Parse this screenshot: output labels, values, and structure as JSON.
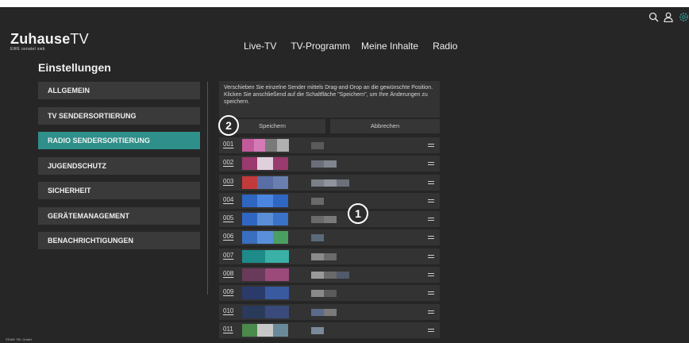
{
  "brand": {
    "name": "Zuhause",
    "name_suffix": "TV",
    "sub": "EWE osnatel swb"
  },
  "nav": {
    "items": [
      "Live-TV",
      "TV-Programm",
      "Meine Inhalte",
      "Radio"
    ]
  },
  "header_icons": [
    "search-icon",
    "user-icon",
    "settings-icon"
  ],
  "colors": {
    "background": "#262626",
    "panel": "#333333",
    "accent": "#2f8f8a",
    "settings_icon": "#2f8f8a"
  },
  "page": {
    "title": "Einstellungen"
  },
  "sidebar": {
    "items": [
      {
        "label": "ALLGEMEIN",
        "active": false
      },
      {
        "label": "TV SENDERSORTIERUNG",
        "active": false
      },
      {
        "label": "RADIO SENDERSORTIERUNG",
        "active": true
      },
      {
        "label": "JUGENDSCHUTZ",
        "active": false
      },
      {
        "label": "SICHERHEIT",
        "active": false
      },
      {
        "label": "GERÄTEMANAGEMENT",
        "active": false
      },
      {
        "label": "BENACHRICHTIGUNGEN",
        "active": false
      }
    ]
  },
  "main": {
    "info_text": "Verschieben Sie einzelne Sender mittels Drag-and-Drop an die gewünschte Position. Klicken Sie anschließend auf die Schaltfläche \"Speichern\", um Ihre Änderungen zu speichern.",
    "save_label": "Speichern",
    "cancel_label": "Abbrechen",
    "marker_1": "1",
    "marker_2": "2",
    "stations": [
      {
        "number": "001",
        "logo_colors": [
          "#c25a9a",
          "#d47ab6",
          "#7a7a7a",
          "#b0b0b0"
        ],
        "name_colors": [
          "#5a5a5a"
        ]
      },
      {
        "number": "002",
        "logo_colors": [
          "#9b3a6e",
          "#e0d0dc",
          "#9b3a6e"
        ],
        "name_colors": [
          "#6a6f7a",
          "#7f858f"
        ]
      },
      {
        "number": "003",
        "logo_colors": [
          "#c33a3a",
          "#5a6ea6",
          "#6a7fae"
        ],
        "name_colors": [
          "#7a7f88",
          "#8f939b",
          "#6c7079"
        ]
      },
      {
        "number": "004",
        "logo_colors": [
          "#2f66c2",
          "#4a86e0",
          "#2f66c2"
        ],
        "name_colors": [
          "#6a6a6a"
        ]
      },
      {
        "number": "005",
        "logo_colors": [
          "#2f66c2",
          "#5a8ed6",
          "#3a72c8"
        ],
        "name_colors": [
          "#6a6a6a",
          "#7a7a7a"
        ]
      },
      {
        "number": "006",
        "logo_colors": [
          "#3a6ec0",
          "#5a90da",
          "#4aa060"
        ],
        "name_colors": [
          "#5a6a7a"
        ]
      },
      {
        "number": "007",
        "logo_colors": [
          "#1e8a8a",
          "#3ab0a6"
        ],
        "name_colors": [
          "#8a8a8a",
          "#6a6a6a"
        ]
      },
      {
        "number": "008",
        "logo_colors": [
          "#6a3a5a",
          "#9b4a7a"
        ],
        "name_colors": [
          "#9a9a9a",
          "#6a6a6a",
          "#505a6a"
        ]
      },
      {
        "number": "009",
        "logo_colors": [
          "#2a3a6a",
          "#3a5aa0"
        ],
        "name_colors": [
          "#8a8a8a",
          "#5a5a5a"
        ]
      },
      {
        "number": "010",
        "logo_colors": [
          "#2a3a5a",
          "#3a4a7a"
        ],
        "name_colors": [
          "#5a6a8a",
          "#7a7a7a"
        ]
      },
      {
        "number": "011",
        "logo_colors": [
          "#4a8a4a",
          "#c8c8c8",
          "#6a8a9a"
        ],
        "name_colors": [
          "#7a8a9a"
        ]
      }
    ]
  },
  "footer": {
    "text": "©EWE TEL GmbH"
  }
}
